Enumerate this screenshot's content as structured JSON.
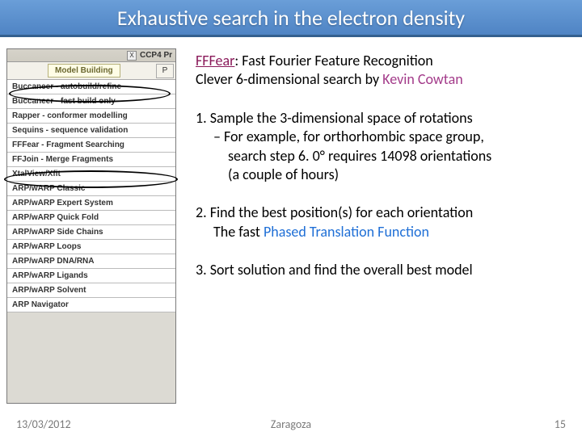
{
  "title": "Exhaustive search in the electron density",
  "panel": {
    "titlebar_close": "X",
    "window_label_right": "CCP4 Pr",
    "tab_label": "Model Building",
    "side_label": "P",
    "items": [
      "Buccaneer - autobuild/refine",
      "Buccaneer - fast build only",
      "Rapper - conformer modelling",
      "Sequins - sequence validation",
      "FFFear - Fragment Searching",
      "FFJoin - Merge Fragments",
      "XtalView/Xfit",
      "ARP/wARP Classic",
      "ARP/wARP Expert System",
      "ARP/wARP Quick Fold",
      "ARP/wARP Side Chains",
      "ARP/wARP Loops",
      "ARP/wARP DNA/RNA",
      "ARP/wARP Ligands",
      "ARP/wARP Solvent",
      "ARP Navigator"
    ]
  },
  "intro": {
    "fffear": "FFFear",
    "line1_rest": ": Fast Fourier Feature Recognition",
    "line2_a": "Clever 6-dimensional search by ",
    "kevin": "Kevin Cowtan"
  },
  "pt1": {
    "head": "1. Sample the 3-dimensional space of rotations",
    "sub1": "– For example, for orthorhombic space group,",
    "sub2": "search step 6. 0° requires 14098 orientations",
    "sub3": "(a couple of hours)"
  },
  "pt2": {
    "head": "2. Find the best position(s) for each orientation",
    "sub_a": "The fast ",
    "sub_link": "Phased Translation Function"
  },
  "pt3": {
    "head": "3. Sort solution and find the overall best model"
  },
  "footer": {
    "date": "13/03/2012",
    "place": "Zaragoza",
    "page": "15"
  }
}
